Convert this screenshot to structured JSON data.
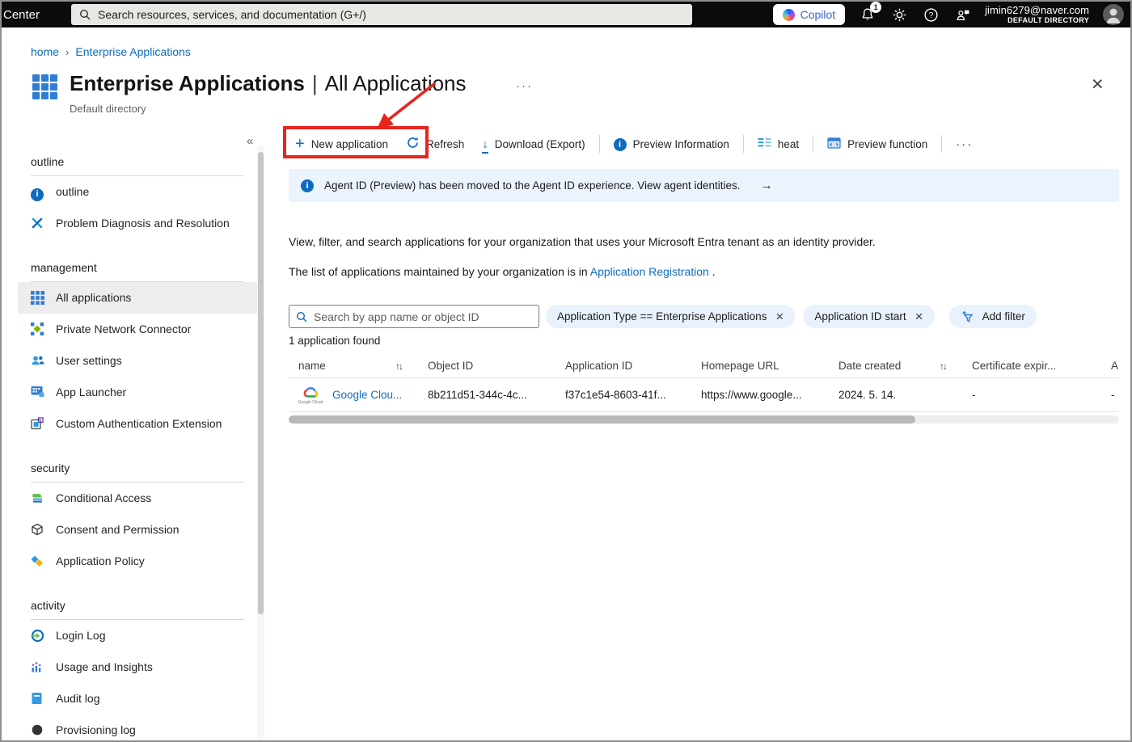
{
  "colors": {
    "topbar_bg": "#0b0b0b",
    "accent_blue": "#0f6cbd",
    "link_blue": "#0f6cbd",
    "annotation_red": "#e8251f",
    "banner_bg": "#ebf3fc",
    "pill_bg": "#e9f2fc",
    "selected_bg": "#ededed"
  },
  "topbar": {
    "window_title": "Center",
    "search_placeholder": "Search resources, services, and documentation (G+/)",
    "copilot_label": "Copilot",
    "notification_count": "1",
    "user_email": "jimin6279@naver.com",
    "user_directory": "DEFAULT DIRECTORY"
  },
  "breadcrumb": {
    "items": [
      {
        "label": "home"
      },
      {
        "label": "Enterprise Applications"
      }
    ],
    "separator": "›"
  },
  "header": {
    "title_bold": "Enterprise Applications",
    "title_separator": "|",
    "title_regular": "All Applications",
    "more_label": "···",
    "subtitle": "Default directory",
    "close_glyph": "×"
  },
  "annotation": {
    "target_label": "New application",
    "color": "#e8251f"
  },
  "sidebar": {
    "collapse_glyph": "«",
    "sections": [
      {
        "header": "outline",
        "items": [
          {
            "label": "outline",
            "icon": "info-icon"
          },
          {
            "label": "Problem Diagnosis and Resolution",
            "icon": "tools-icon"
          }
        ]
      },
      {
        "header": "management",
        "items": [
          {
            "label": "All applications",
            "icon": "grid-icon",
            "selected": true
          },
          {
            "label": "Private Network Connector",
            "icon": "connector-icon"
          },
          {
            "label": "User settings",
            "icon": "users-icon"
          },
          {
            "label": "App Launcher",
            "icon": "launcher-icon"
          },
          {
            "label": "Custom Authentication Extension",
            "icon": "extension-icon"
          }
        ]
      },
      {
        "header": "security",
        "items": [
          {
            "label": "Conditional Access",
            "icon": "layers-icon"
          },
          {
            "label": "Consent and Permission",
            "icon": "cube-icon"
          },
          {
            "label": "Application Policy",
            "icon": "policy-icon"
          }
        ]
      },
      {
        "header": "activity",
        "items": [
          {
            "label": "Login Log",
            "icon": "login-icon"
          },
          {
            "label": "Usage and Insights",
            "icon": "chart-icon"
          },
          {
            "label": "Audit log",
            "icon": "audit-icon"
          },
          {
            "label": "Provisioning log",
            "icon": "provisioning-icon",
            "clipped": true
          }
        ]
      }
    ]
  },
  "toolbar": {
    "items": [
      {
        "label": "New application",
        "icon": "plus-icon",
        "highlighted": true
      },
      {
        "label": "Refresh",
        "icon": "refresh-icon"
      },
      {
        "label": "Download (Export)",
        "icon": "download-icon"
      },
      {
        "divider": true
      },
      {
        "label": "Preview Information",
        "icon": "info-icon"
      },
      {
        "divider": true
      },
      {
        "label": "heat",
        "icon": "columns-icon"
      },
      {
        "divider": true
      },
      {
        "label": "Preview function",
        "icon": "preview-window-icon"
      },
      {
        "divider": true
      },
      {
        "label": "···",
        "icon": null,
        "name": "more-button"
      }
    ]
  },
  "banner": {
    "text": "Agent ID (Preview) has been moved to the Agent ID experience. View agent identities.",
    "arrow": "→"
  },
  "description": {
    "line1": "View, filter, and search applications for your organization that uses your Microsoft Entra tenant as an identity provider.",
    "line2_prefix": "The list of applications maintained by your organization is in ",
    "line2_link": "Application Registration",
    "line2_suffix": " ."
  },
  "filters": {
    "search_placeholder": "Search by app name or object ID",
    "pills": [
      {
        "text": "Application Type == Enterprise Applications",
        "removable": true
      },
      {
        "text": "Application ID start",
        "removable": true
      }
    ],
    "add_filter_label": "Add filter",
    "remove_glyph": "×"
  },
  "results": {
    "count_text": "1 application found"
  },
  "table": {
    "sort_glyph": "↑↓",
    "columns": [
      {
        "label": "name",
        "sortable": true
      },
      {
        "label": "Object ID"
      },
      {
        "label": "Application ID"
      },
      {
        "label": "Homepage URL"
      },
      {
        "label": "Date created",
        "sortable": true
      },
      {
        "label": "Certificate expir..."
      },
      {
        "label": "A",
        "truncated": true
      }
    ],
    "rows": [
      {
        "name": "Google Clou...",
        "icon": "google-cloud-logo",
        "icon_caption": "Google Cloud",
        "object_id": "8b211d51-344c-4c...",
        "application_id": "f37c1e54-8603-41f...",
        "homepage_url": "https://www.google...",
        "date_created": "2024. 5. 14.",
        "certificate": "-",
        "last": "-"
      }
    ]
  }
}
